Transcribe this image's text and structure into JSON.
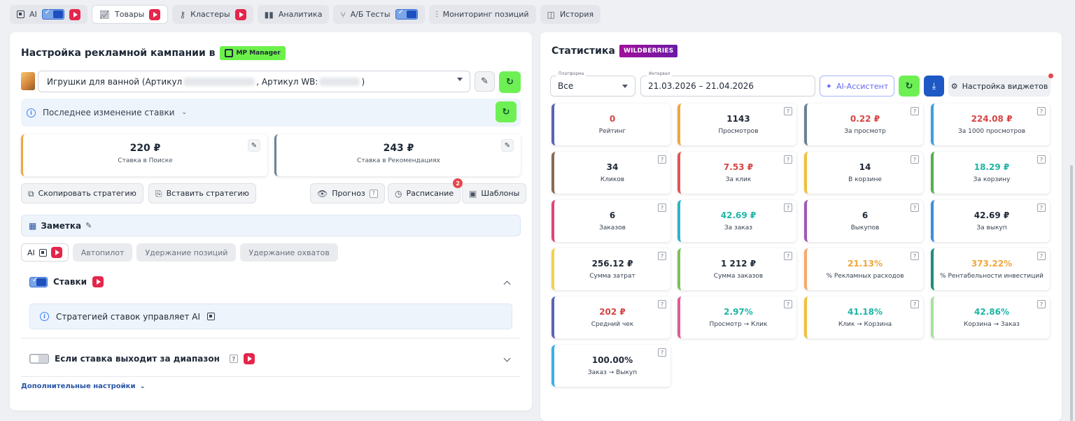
{
  "top_tabs": [
    {
      "label": "AI",
      "icon": "chip-icon",
      "toggle": true,
      "video": true
    },
    {
      "label": "Товары",
      "icon": "chart-line-icon",
      "video": true,
      "active": true
    },
    {
      "label": "Кластеры",
      "icon": "key-icon",
      "video": true
    },
    {
      "label": "Аналитика",
      "icon": "bar-chart-icon"
    },
    {
      "label": "А/Б Тесты",
      "icon": "split-icon",
      "toggle": true
    },
    {
      "label": "Мониторинг позиций",
      "icon": "sliders-icon"
    },
    {
      "label": "История",
      "icon": "history-icon"
    }
  ],
  "left": {
    "title": "Настройка рекламной кампании в",
    "mp_badge": "MP Manager",
    "product": {
      "prefix": "Игрушки для ванной (Артикул",
      "middle": ", Артикул WB:",
      "suffix": ")"
    },
    "last_change": "Последнее изменение ставки",
    "bids": [
      {
        "value": "220 ₽",
        "label": "Ставка в Поиске",
        "color": "#f0a73a"
      },
      {
        "value": "243 ₽",
        "label": "Ставка в Рекомендациях",
        "color": "#6b8296"
      }
    ],
    "actions": {
      "copy": "Скопировать стратегию",
      "paste": "Вставить стратегию",
      "forecast": "Прогноз",
      "schedule": "Расписание",
      "schedule_badge": "2",
      "templates": "Шаблоны"
    },
    "note": "Заметка",
    "modes": {
      "ai": "AI",
      "autopilot": "Автопилот",
      "hold_positions": "Удержание позиций",
      "hold_reach": "Удержание охватов"
    },
    "bids_section": {
      "title": "Ставки",
      "info": "Стратегией ставок управляет AI"
    },
    "range_section": {
      "title": "Если ставка выходит за диапазон"
    },
    "more": "Дополнительные настройки"
  },
  "right": {
    "title": "Статистика",
    "wb_badge": "WILDBERRIES",
    "platform": {
      "label": "Платформа",
      "value": "Все"
    },
    "interval": {
      "label": "Интервал",
      "value": "21.03.2026 – 21.04.2026"
    },
    "ai_assistant": "AI-Ассистент",
    "widgets": "Настройка виджетов",
    "stats": [
      {
        "value": "0",
        "label": "Рейтинг",
        "color": "#d64545",
        "accent": "#5b62b5"
      },
      {
        "value": "1143",
        "label": "Просмотров",
        "color": "#1f2937",
        "accent": "#f0a73a"
      },
      {
        "value": "0.22 ₽",
        "label": "За просмотр",
        "color": "#d64545",
        "accent": "#6b8296"
      },
      {
        "value": "224.08 ₽",
        "label": "За 1000 просмотров",
        "color": "#d64545",
        "accent": "#3aa0e0"
      },
      {
        "value": "34",
        "label": "Кликов",
        "color": "#1f2937",
        "accent": "#8a6a4e"
      },
      {
        "value": "7.53 ₽",
        "label": "За клик",
        "color": "#d64545",
        "accent": "#e05555"
      },
      {
        "value": "14",
        "label": "В корзине",
        "color": "#1f2937",
        "accent": "#f0c03a"
      },
      {
        "value": "18.29 ₽",
        "label": "За корзину",
        "color": "#1fb5a6",
        "accent": "#52b04a"
      },
      {
        "value": "6",
        "label": "Заказов",
        "color": "#1f2937",
        "accent": "#e0437a"
      },
      {
        "value": "42.69 ₽",
        "label": "За заказ",
        "color": "#1fb5a6",
        "accent": "#2bb5c8"
      },
      {
        "value": "6",
        "label": "Выкупов",
        "color": "#1f2937",
        "accent": "#9b59b6"
      },
      {
        "value": "42.69 ₽",
        "label": "За выкуп",
        "color": "#1f2937",
        "accent": "#3a8fe0"
      },
      {
        "value": "256.12 ₽",
        "label": "Сумма затрат",
        "color": "#1f2937",
        "accent": "#f0d050"
      },
      {
        "value": "1 212 ₽",
        "label": "Сумма заказов",
        "color": "#1f2937",
        "accent": "#7cc05a"
      },
      {
        "value": "21.13%",
        "label": "% Рекламных расходов",
        "color": "#f0a73a",
        "accent": "#f6a96a"
      },
      {
        "value": "373.22%",
        "label": "% Рентабельности инвестиций",
        "color": "#f0a73a",
        "accent": "#1a8f7a"
      },
      {
        "value": "202 ₽",
        "label": "Средний чек",
        "color": "#d64545",
        "accent": "#5b62b5"
      },
      {
        "value": "2.97%",
        "label": "Просмотр → Клик",
        "color": "#1fb5a6",
        "accent": "#e05a9a"
      },
      {
        "value": "41.18%",
        "label": "Клик → Корзина",
        "color": "#1fb5a6",
        "accent": "#f0c03a"
      },
      {
        "value": "42.86%",
        "label": "Корзина → Заказ",
        "color": "#1fb5a6",
        "accent": "#a8e0a0"
      },
      {
        "value": "100.00%",
        "label": "Заказ → Выкуп",
        "color": "#1f2937",
        "accent": "#3ab0e8"
      }
    ]
  }
}
